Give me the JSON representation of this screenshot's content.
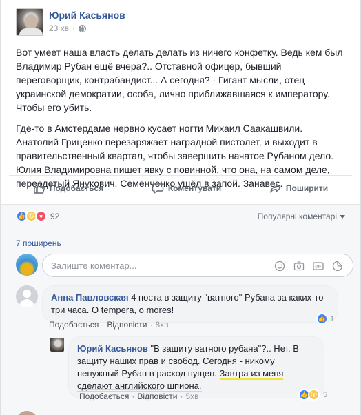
{
  "post": {
    "author": "Юрий Касьянов",
    "time": "23 хв",
    "paragraphs": [
      "Вот умеет наша власть делать делать из ничего конфетку. Ведь кем был Владимир Рубан ещё вчера?.. Отставной офицер, бывший переговорщик, контрабандист... А сегодня? - Гигант мысли, отец украинской демократии, особа, лично приближавшаяся к императору. Чтобы его убить.",
      "Где-то в Амстердаме нервно кусает ногти Михаил Саакашвили. Анатолий Гриценко перезаряжает наградной пистолет, и выходит в правительственный квартал, чтобы завершить начатое Рубаном дело. Юлия Владимировна пишет явку с повинной, что она, на самом деле, переодетый Янукович. Семенченко ушёл в запой. Занавес."
    ]
  },
  "actions": {
    "like": "Подобається",
    "comment": "Коментувати",
    "share": "Поширити"
  },
  "reactions": {
    "count": "92",
    "sort_label": "Популярні коментарі"
  },
  "shares": "7 поширень",
  "composer": {
    "placeholder": "Залиште коментар..."
  },
  "comments": [
    {
      "author": "Анна Павловская",
      "text": "4 поста в защиту \"ватного\" Рубана за каких-то три часа. O tempera, o mores!",
      "like_label": "Подобається",
      "reply_label": "Відповісти",
      "time": "8хв",
      "reaction_count": "1"
    },
    {
      "author": "Юрий Касьянов",
      "text_a": "\"В защиту ватного рубана\"?.. Нет. В защиту наших прав и свобод. Сегодня - никому ненужный Рубан в расход пущен. ",
      "text_b": "Завтра из меня сделают английского шпиона.",
      "like_label": "Подобається",
      "reply_label": "Відповісти",
      "time": "5хв",
      "reaction_count": "5"
    }
  ],
  "colors": {
    "link": "#365899",
    "like_blue": "#4080ff",
    "highlight": "#f2e33a"
  }
}
